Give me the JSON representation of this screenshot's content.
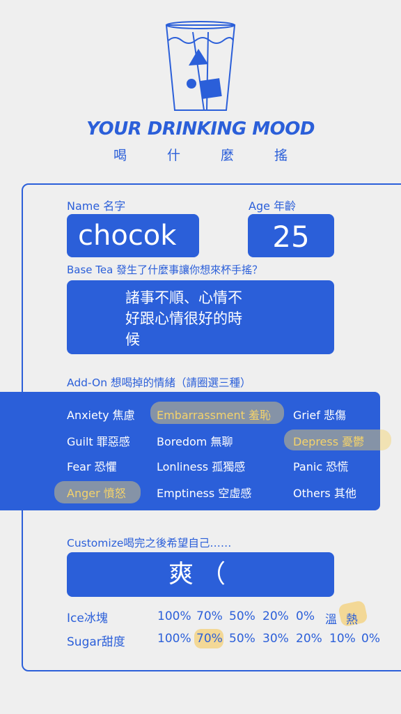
{
  "header": {
    "title": "YOUR DRINKING MOOD",
    "subtitle": "喝什麼搖"
  },
  "form": {
    "name_label": "Name 名字",
    "name_value": "chocok",
    "age_label": "Age 年齡",
    "age_value": "25",
    "base_tea_label": "Base Tea 發生了什麼事讓你想來杯手搖？",
    "base_tea_value": "諸事不順、心情不\n好跟心情很好的時\n候",
    "addon_label": "Add-On 想喝掉的情緒（請圈選三種）",
    "emotions": [
      {
        "label": "Anxiety 焦慮",
        "selected": false
      },
      {
        "label": "Embarrassment 羞恥",
        "selected": true
      },
      {
        "label": "Grief 悲傷",
        "selected": false
      },
      {
        "label": "Guilt 罪惡感",
        "selected": false
      },
      {
        "label": "Boredom 無聊",
        "selected": false
      },
      {
        "label": "Depress 憂鬱",
        "selected": true
      },
      {
        "label": "Fear 恐懼",
        "selected": false
      },
      {
        "label": "Lonliness 孤獨感",
        "selected": false
      },
      {
        "label": "Panic 恐慌",
        "selected": false
      },
      {
        "label": "Anger 憤怒",
        "selected": true
      },
      {
        "label": "Emptiness 空虛感",
        "selected": false
      },
      {
        "label": "Others 其他",
        "selected": false
      }
    ],
    "customize_label": "Customize喝完之後希望自己……",
    "customize_value": "爽（",
    "ice_label": "Ice冰塊",
    "ice_options": [
      "100%",
      "70%",
      "50%",
      "20%",
      "0%",
      "溫",
      "熱"
    ],
    "ice_selected": "熱",
    "sugar_label": "Sugar甜度",
    "sugar_options": [
      "100%",
      "70%",
      "50%",
      "30%",
      "20%",
      "10%",
      "0%"
    ],
    "sugar_selected": "70%"
  },
  "colors": {
    "accent": "#2b5fd9",
    "background": "#efefef",
    "highlight": "#f5d36a"
  },
  "icons": {
    "logo": "drink-cup-icon"
  }
}
